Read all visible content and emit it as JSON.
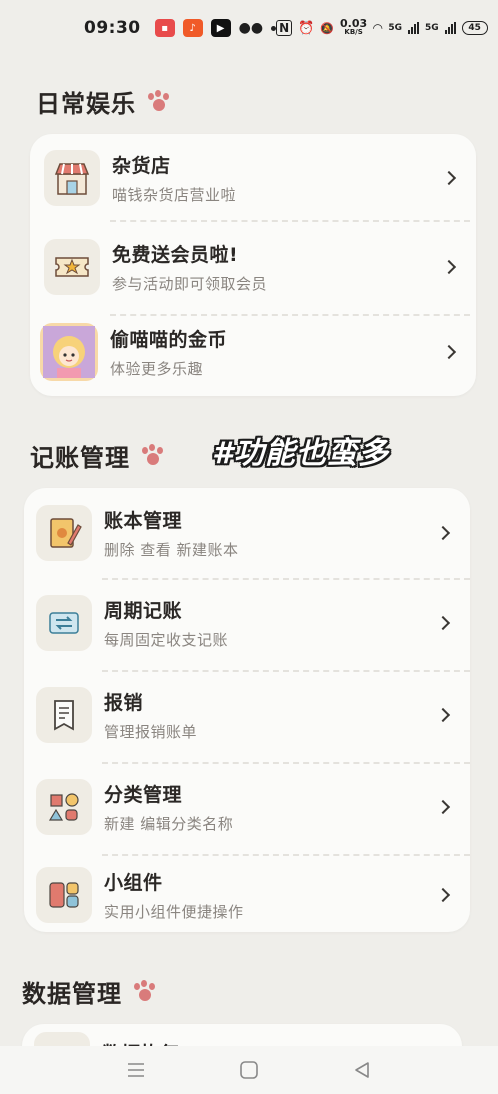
{
  "status_bar": {
    "time": "09:30",
    "net_speed_value": "0.03",
    "net_speed_unit": "KB/S",
    "network_label_1": "5G",
    "network_label_2": "5G",
    "battery": "45"
  },
  "sections": [
    {
      "title": "日常娱乐",
      "items": [
        {
          "title": "杂货店",
          "subtitle": "喵钱杂货店营业啦",
          "icon": "shop-icon"
        },
        {
          "title": "免费送会员啦!",
          "subtitle": "参与活动即可领取会员",
          "icon": "ticket-icon"
        },
        {
          "title": "偷喵喵的金币",
          "subtitle": "体验更多乐趣",
          "icon": "character-avatar-icon"
        }
      ]
    },
    {
      "title": "记账管理",
      "items": [
        {
          "title": "账本管理",
          "subtitle": "删除 查看 新建账本",
          "icon": "ledger-icon"
        },
        {
          "title": "周期记账",
          "subtitle": "每周固定收支记账",
          "icon": "cycle-icon"
        },
        {
          "title": "报销",
          "subtitle": "管理报销账单",
          "icon": "reimburse-icon"
        },
        {
          "title": "分类管理",
          "subtitle": "新建 编辑分类名称",
          "icon": "category-icon"
        },
        {
          "title": "小组件",
          "subtitle": "实用小组件便捷操作",
          "icon": "widget-icon"
        }
      ]
    },
    {
      "title": "数据管理",
      "items": [
        {
          "title": "数据恢复",
          "subtitle": "",
          "icon": "data-icon"
        }
      ]
    }
  ],
  "overlay_caption": "#功能也蛮多",
  "colors": {
    "background": "#efeeea",
    "card": "#fbfbf9",
    "paw": "#d97b7b",
    "subtitle": "#8a8580"
  }
}
